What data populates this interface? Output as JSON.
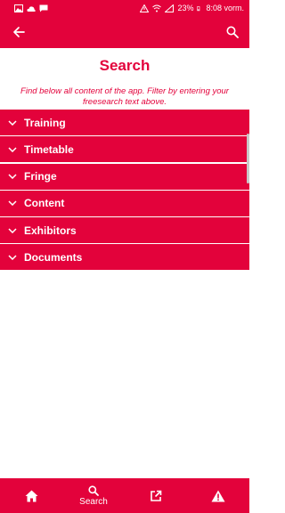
{
  "status_bar": {
    "battery": "23%",
    "time": "8:08 vorm.",
    "left_icons": [
      "image-icon",
      "cloud-icon",
      "message-icon"
    ],
    "right_icons": [
      "alert-icon",
      "wifi-icon",
      "signal-icon",
      "battery-icon"
    ]
  },
  "header": {
    "back_icon": "arrow-left-icon",
    "search_icon": "search-icon"
  },
  "page": {
    "title": "Search",
    "description": "Find below all content of the app. Filter by entering your freesearch text above."
  },
  "sections": [
    {
      "label": "Training"
    },
    {
      "label": "Timetable"
    },
    {
      "label": "Fringe"
    },
    {
      "label": "Content"
    },
    {
      "label": "Exhibitors"
    },
    {
      "label": "Documents"
    }
  ],
  "bottom_nav": {
    "home_icon": "home-icon",
    "search_label": "Search",
    "search_icon": "search-icon",
    "external_icon": "external-link-icon",
    "alert_icon": "warning-icon"
  },
  "colors": {
    "brand": "#e3023b",
    "text_on_brand": "#ffffff"
  }
}
